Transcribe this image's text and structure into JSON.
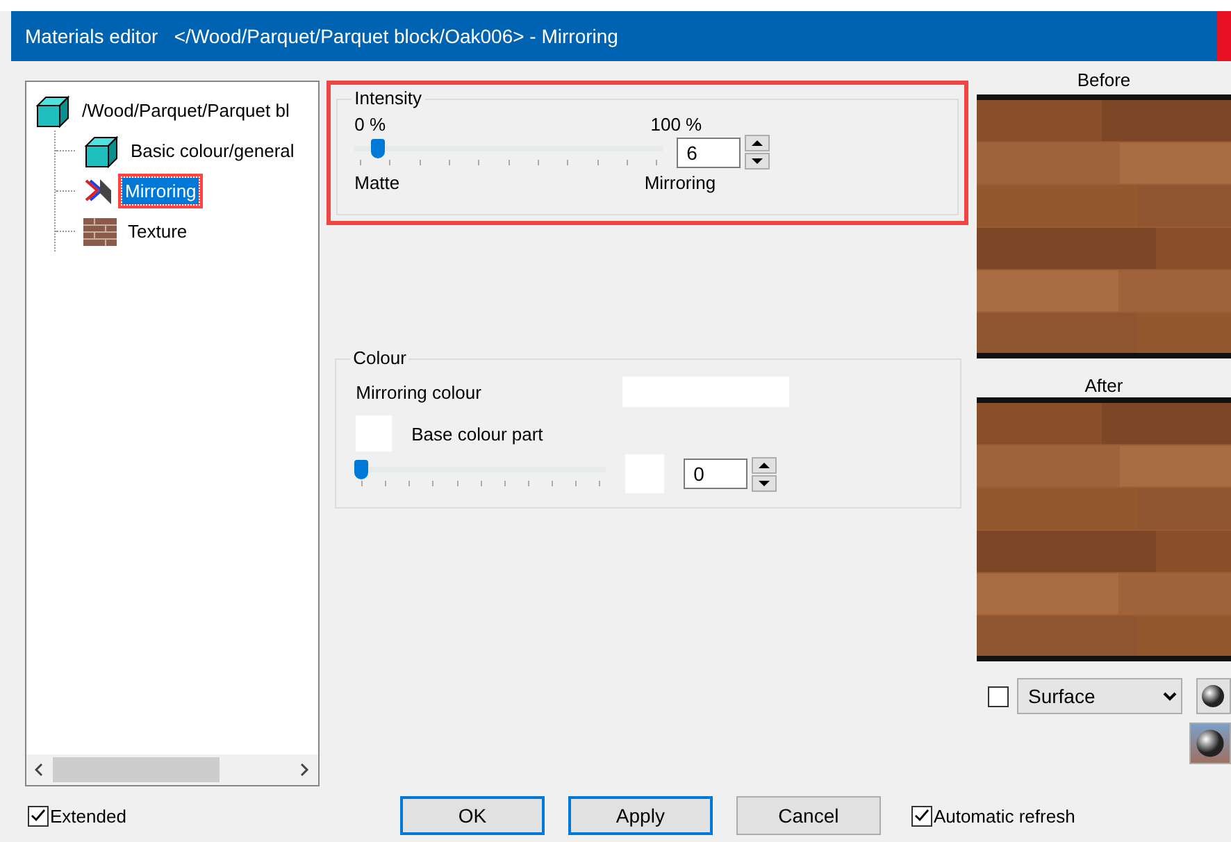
{
  "window": {
    "title": "Materials editor   </Wood/Parquet/Parquet block/Oak006> - Mirroring"
  },
  "tree": {
    "root": {
      "label": "/Wood/Parquet/Parquet bl",
      "kind": "cube",
      "children": [
        {
          "label": "Basic colour/general",
          "kind": "cube",
          "selected": false,
          "highlighted": false
        },
        {
          "label": "Mirroring",
          "kind": "mirror",
          "selected": true,
          "highlighted": true
        },
        {
          "label": "Texture",
          "kind": "brick",
          "selected": false,
          "highlighted": false
        }
      ]
    }
  },
  "intensity": {
    "title": "Intensity",
    "min_label": "0 %",
    "max_label": "100 %",
    "level": 0.06,
    "value": "6",
    "left_label": "Matte",
    "right_label": "Mirroring",
    "highlighted": true
  },
  "colour": {
    "title": "Colour",
    "mirroring_colour_label": "Mirroring colour",
    "base_colour_label": "Base colour part",
    "level": 0,
    "value": "0"
  },
  "preview": {
    "before_label": "Before",
    "after_label": "After",
    "option_checked": false,
    "mode": "Surface"
  },
  "footer": {
    "extended": {
      "label": "Extended",
      "checked": true
    },
    "buttons": [
      {
        "label": "OK",
        "focused": true
      },
      {
        "label": "Apply",
        "focused": true
      },
      {
        "label": "Cancel",
        "focused": false
      }
    ],
    "auto_refresh": {
      "label": "Automatic refresh",
      "checked": true
    }
  }
}
